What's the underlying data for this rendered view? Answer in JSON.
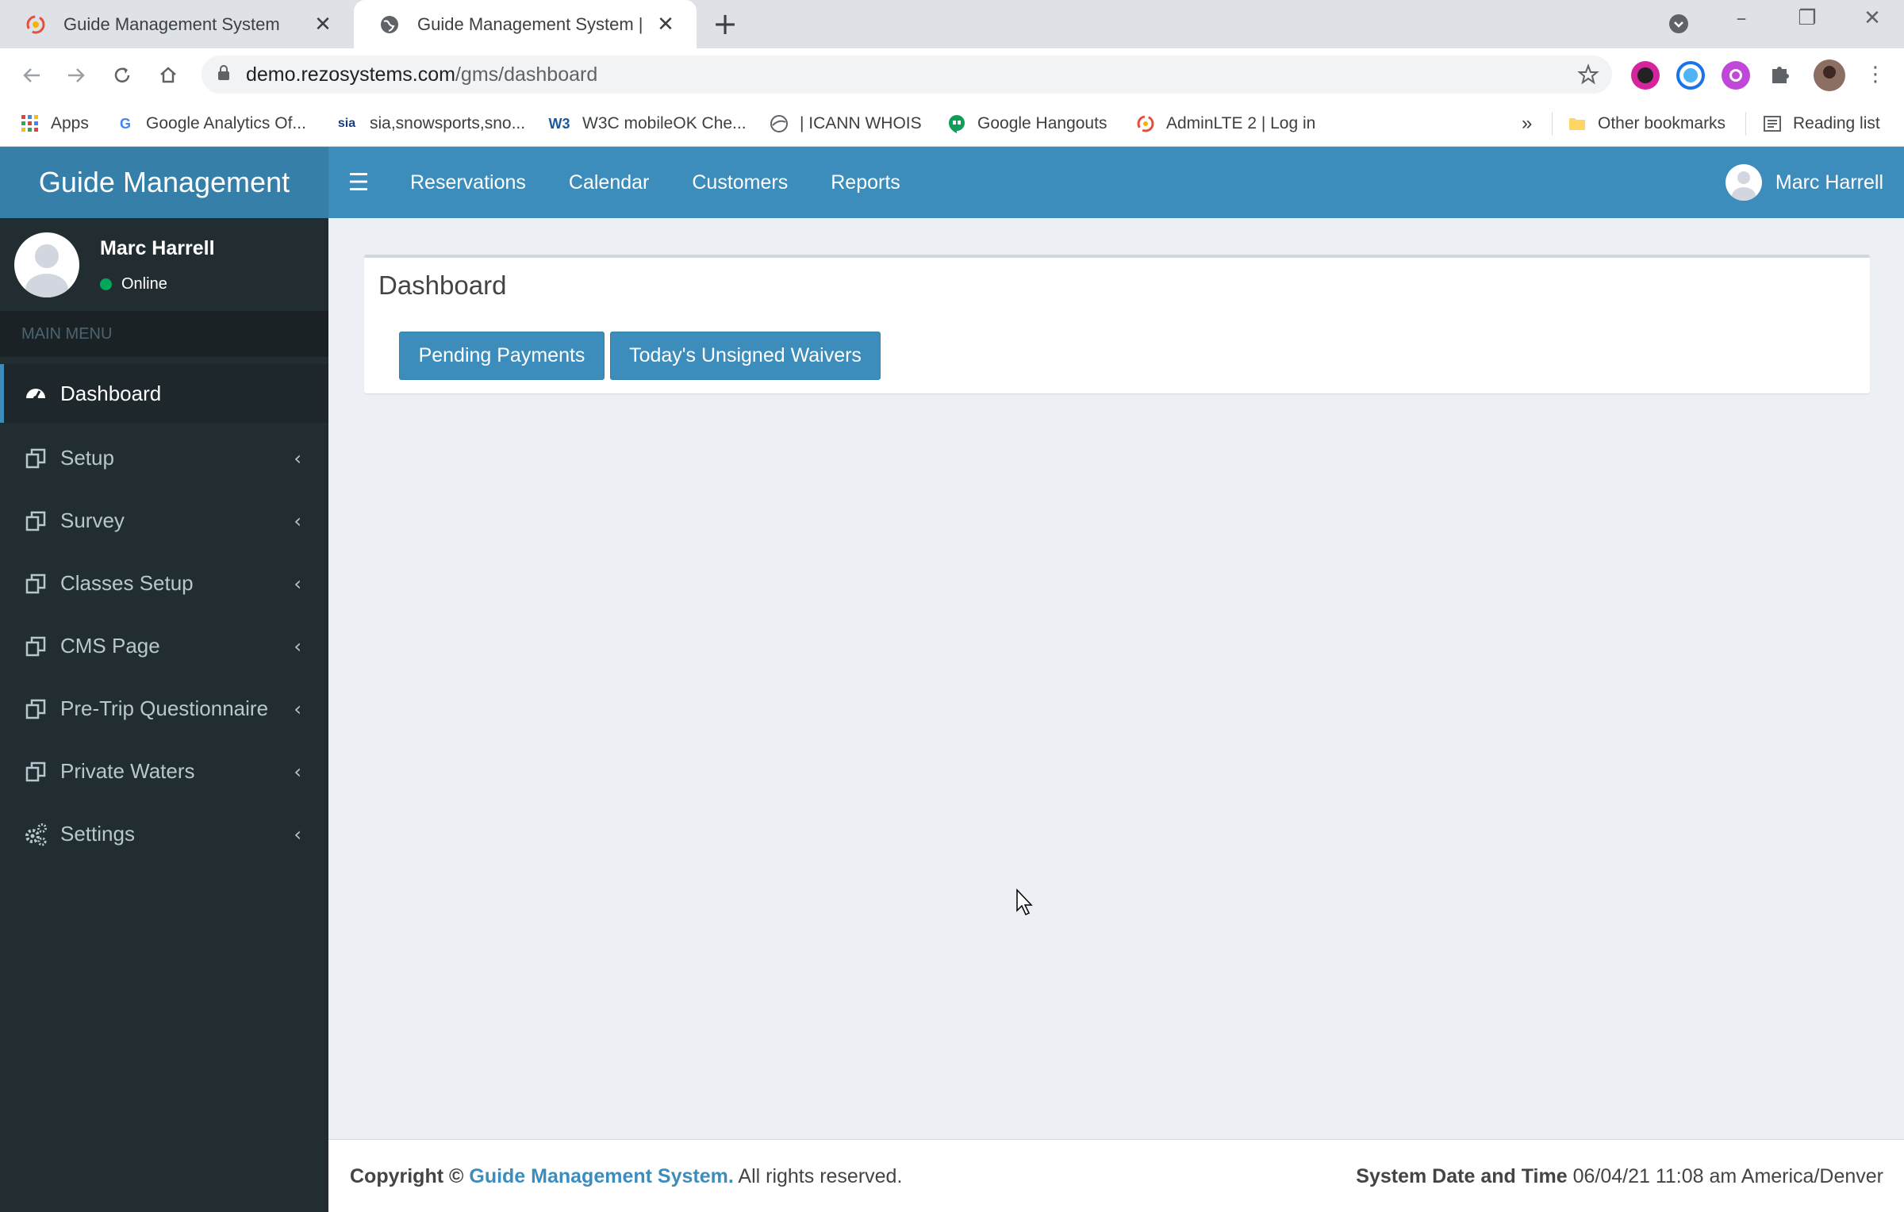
{
  "browser": {
    "tabs": [
      {
        "title": "Guide Management System",
        "active": false
      },
      {
        "title": "Guide Management System | Das",
        "active": true
      }
    ],
    "url_host": "demo.rezosystems.com",
    "url_path": "/gms/dashboard",
    "bookmarks": [
      {
        "label": "Apps"
      },
      {
        "label": "Google Analytics Of..."
      },
      {
        "label": "sia,snowsports,sno..."
      },
      {
        "label": "W3C mobileOK Che..."
      },
      {
        "label": "| ICANN WHOIS"
      },
      {
        "label": "Google Hangouts"
      },
      {
        "label": "AdminLTE 2 | Log in"
      }
    ],
    "overflow": "»",
    "other_bookmarks": "Other bookmarks",
    "reading_list": "Reading list"
  },
  "header": {
    "logo": "Guide Management",
    "nav": [
      "Reservations",
      "Calendar",
      "Customers",
      "Reports"
    ],
    "user_name": "Marc Harrell"
  },
  "sidebar": {
    "user_name": "Marc Harrell",
    "status": "Online",
    "menu_header": "MAIN MENU",
    "items": [
      {
        "label": "Dashboard",
        "icon": "dashboard-icon",
        "active": true
      },
      {
        "label": "Setup",
        "icon": "copy-icon"
      },
      {
        "label": "Survey",
        "icon": "copy-icon"
      },
      {
        "label": "Classes Setup",
        "icon": "copy-icon"
      },
      {
        "label": "CMS Page",
        "icon": "copy-icon"
      },
      {
        "label": "Pre-Trip Questionnaire",
        "icon": "copy-icon"
      },
      {
        "label": "Private Waters",
        "icon": "copy-icon"
      },
      {
        "label": "Settings",
        "icon": "gears-icon"
      }
    ]
  },
  "content": {
    "title": "Dashboard",
    "buttons": [
      "Pending Payments",
      "Today's Unsigned Waivers"
    ]
  },
  "footer": {
    "copyright_prefix": "Copyright ©",
    "company": "Guide Management System.",
    "rights": "All rights reserved.",
    "datetime_label": "System Date and Time",
    "datetime_value": "06/04/21 11:08 am America/Denver"
  },
  "colors": {
    "header": "#3c8dbc",
    "logo_bg": "#367fa9",
    "sidebar": "#222d32",
    "content_bg": "#ecf0f5",
    "online": "#00a65a"
  }
}
